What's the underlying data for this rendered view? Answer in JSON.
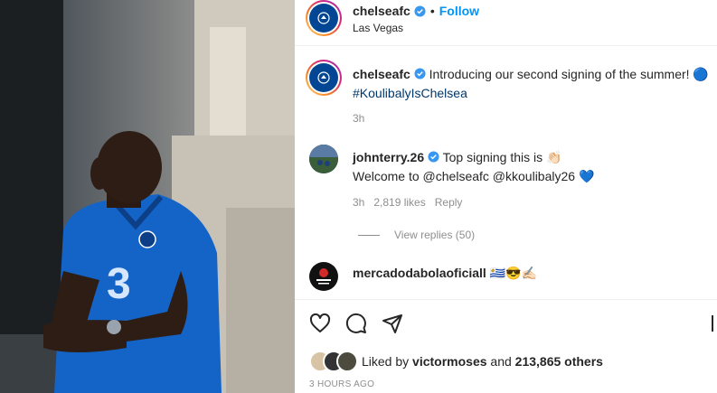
{
  "header": {
    "username": "chelseafc",
    "follow_label": "Follow",
    "location": "Las Vegas"
  },
  "caption": {
    "username": "chelseafc",
    "text": "Introducing our second signing of the summer! 🔵",
    "hashtag": "#KoulibalyIsChelsea",
    "time": "3h"
  },
  "comments": [
    {
      "username": "johnterry.26",
      "text_line1": "Top signing this is 👏🏻",
      "text_line2": "Welcome to @chelseafc @kkoulibaly26 💙",
      "time": "3h",
      "likes": "2,819 likes",
      "reply_label": "Reply",
      "view_replies": "View replies (50)"
    },
    {
      "username": "mercadodabolaoficiall",
      "text": "🇺🇾😎✍🏻"
    }
  ],
  "likes": {
    "prefix": "Liked by ",
    "user": "victormoses",
    "middle": " and ",
    "count": "213,865 others"
  },
  "timestamp": "3 HOURS AGO",
  "colors": {
    "accent": "#0095f6",
    "chelsea_blue": "#034694",
    "jersey_blue": "#1464c8"
  }
}
